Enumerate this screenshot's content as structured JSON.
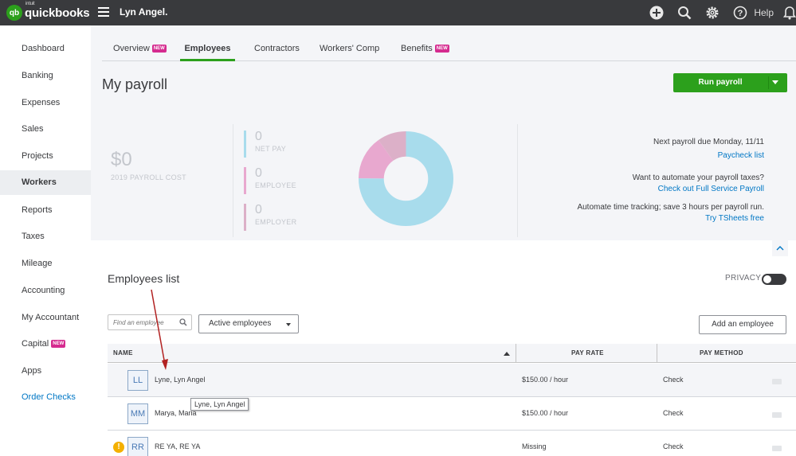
{
  "brand": {
    "mark": "qb",
    "intuit": "intuit",
    "name": "quickbooks"
  },
  "header": {
    "company": "Lyn Angel.",
    "help_label": "Help"
  },
  "icons": {
    "create": "plus-circle-icon",
    "search": "search-icon",
    "settings": "gear-icon",
    "help": "question-circle-icon",
    "notifications": "bell-icon",
    "menu": "hamburger-menu-icon"
  },
  "colors": {
    "brand_green": "#2ca01c",
    "topbar": "#393a3d",
    "link": "#0077c5",
    "new_badge": "#d52b8f",
    "net_pay": "#a8dcec",
    "employee": "#e8a8cf",
    "employer": "#dcb0c8"
  },
  "sidebar": {
    "items": [
      {
        "label": "Dashboard"
      },
      {
        "label": "Banking"
      },
      {
        "label": "Expenses"
      },
      {
        "label": "Sales"
      },
      {
        "label": "Projects"
      },
      {
        "label": "Workers",
        "active": true
      },
      {
        "label": "Reports"
      },
      {
        "label": "Taxes"
      },
      {
        "label": "Mileage"
      },
      {
        "label": "Accounting"
      },
      {
        "label": "My Accountant"
      },
      {
        "label": "Capital",
        "badge": "NEW"
      },
      {
        "label": "Apps"
      },
      {
        "label": "Order Checks",
        "link": true
      }
    ]
  },
  "tabs": [
    {
      "label": "Overview",
      "badge": "NEW"
    },
    {
      "label": "Employees",
      "active": true
    },
    {
      "label": "Contractors"
    },
    {
      "label": "Workers' Comp"
    },
    {
      "label": "Benefits",
      "badge": "NEW"
    }
  ],
  "page": {
    "title": "My payroll",
    "run_payroll": "Run payroll"
  },
  "summary": {
    "total_cost": "$0",
    "total_cost_label": "2019 PAYROLL COST",
    "net_pay": {
      "value": "0",
      "label": "NET PAY"
    },
    "employee": {
      "value": "0",
      "label": "EMPLOYEE"
    },
    "employer": {
      "value": "0",
      "label": "EMPLOYER"
    },
    "next_payroll": "Next payroll due Monday, 11/11",
    "paycheck_list": "Paycheck list",
    "automate_taxes": "Want to automate your payroll taxes?",
    "full_service": "Check out Full Service Payroll",
    "time_tracking": "Automate time tracking; save 3 hours per payroll run.",
    "tsheets": "Try TSheets free"
  },
  "donut": {
    "segments": [
      {
        "name": "net pay",
        "fraction": 0.75,
        "color": "#a8dcec"
      },
      {
        "name": "employee",
        "fraction": 0.15,
        "color": "#e8a8cf"
      },
      {
        "name": "employer",
        "fraction": 0.1,
        "color": "#dcb0c8"
      }
    ]
  },
  "employees": {
    "title": "Employees list",
    "privacy_label": "PRIVACY",
    "search_placeholder": "Find an employee",
    "filter": "Active employees",
    "add_button": "Add an employee",
    "columns": {
      "name": "NAME",
      "pay_rate": "PAY RATE",
      "pay_method": "PAY METHOD"
    },
    "rows": [
      {
        "initials": "LL",
        "name": "Lyne, Lyn Angel",
        "pay_rate": "$150.00 / hour",
        "pay_method": "Check"
      },
      {
        "initials": "MM",
        "name": "Marya, Maria",
        "pay_rate": "$150.00 / hour",
        "pay_method": "Check"
      },
      {
        "initials": "RR",
        "name": "RE YA, RE YA",
        "pay_rate": "Missing",
        "pay_method": "Check",
        "warning": "!"
      }
    ],
    "tooltip": "Lyne, Lyn Angel"
  }
}
